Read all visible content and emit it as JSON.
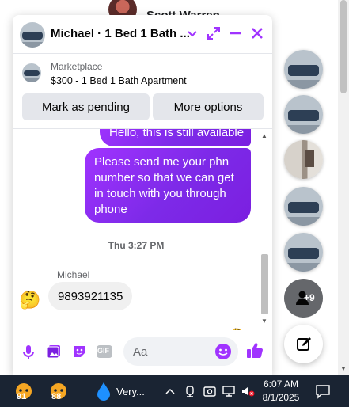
{
  "background": {
    "contact_name": "Scott Warren"
  },
  "chat": {
    "title": "Michael · 1 Bed 1 Bath ...",
    "header_buttons": {
      "options_icon": "chevron-down-icon",
      "expand_icon": "expand-icon",
      "minimize_icon": "minimize-icon",
      "close_icon": "close-icon"
    },
    "marketplace": {
      "label": "Marketplace",
      "item": "$300 - 1 Bed 1 Bath Apartment",
      "pending_button": "Mark as pending",
      "options_button": "More options"
    },
    "messages": {
      "previous_outgoing": "Hello, this is still available",
      "outgoing": "Please send me your phn number so that we can get in touch with you through phone",
      "timestamp": "Thu 3:27 PM",
      "sender": "Michael",
      "incoming": "9893921135"
    },
    "composer": {
      "placeholder": "Aa",
      "icons": [
        "microphone-icon",
        "photo-icon",
        "sticker-icon",
        "gif-icon",
        "emoji-icon",
        "like-icon"
      ],
      "gif_label": "GIF"
    }
  },
  "sidebar": {
    "more_count": "+9"
  },
  "taskbar": {
    "weather_1": "91",
    "weather_2": "88",
    "weather_text": "Very...",
    "time": "6:07 AM",
    "date": "8/1/2025"
  },
  "colors": {
    "accent": "#a033ff",
    "accent_dark": "#7b1fe0",
    "like": "#0a7cff",
    "taskbar": "#1a2433"
  }
}
